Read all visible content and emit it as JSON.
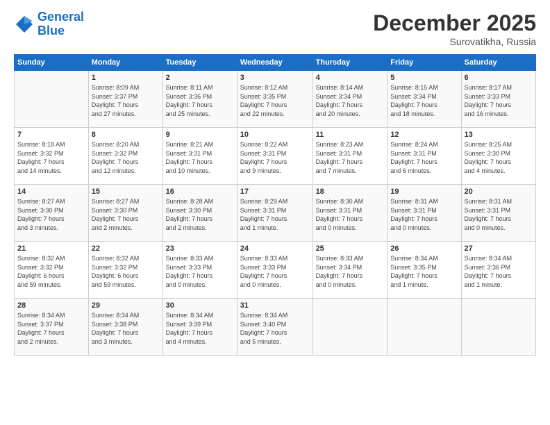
{
  "header": {
    "logo_line1": "General",
    "logo_line2": "Blue",
    "month": "December 2025",
    "location": "Surovatikha, Russia"
  },
  "weekdays": [
    "Sunday",
    "Monday",
    "Tuesday",
    "Wednesday",
    "Thursday",
    "Friday",
    "Saturday"
  ],
  "weeks": [
    [
      {
        "day": "",
        "info": ""
      },
      {
        "day": "1",
        "info": "Sunrise: 8:09 AM\nSunset: 3:37 PM\nDaylight: 7 hours\nand 27 minutes."
      },
      {
        "day": "2",
        "info": "Sunrise: 8:11 AM\nSunset: 3:36 PM\nDaylight: 7 hours\nand 25 minutes."
      },
      {
        "day": "3",
        "info": "Sunrise: 8:12 AM\nSunset: 3:35 PM\nDaylight: 7 hours\nand 22 minutes."
      },
      {
        "day": "4",
        "info": "Sunrise: 8:14 AM\nSunset: 3:34 PM\nDaylight: 7 hours\nand 20 minutes."
      },
      {
        "day": "5",
        "info": "Sunrise: 8:15 AM\nSunset: 3:34 PM\nDaylight: 7 hours\nand 18 minutes."
      },
      {
        "day": "6",
        "info": "Sunrise: 8:17 AM\nSunset: 3:33 PM\nDaylight: 7 hours\nand 16 minutes."
      }
    ],
    [
      {
        "day": "7",
        "info": "Sunrise: 8:18 AM\nSunset: 3:32 PM\nDaylight: 7 hours\nand 14 minutes."
      },
      {
        "day": "8",
        "info": "Sunrise: 8:20 AM\nSunset: 3:32 PM\nDaylight: 7 hours\nand 12 minutes."
      },
      {
        "day": "9",
        "info": "Sunrise: 8:21 AM\nSunset: 3:31 PM\nDaylight: 7 hours\nand 10 minutes."
      },
      {
        "day": "10",
        "info": "Sunrise: 8:22 AM\nSunset: 3:31 PM\nDaylight: 7 hours\nand 9 minutes."
      },
      {
        "day": "11",
        "info": "Sunrise: 8:23 AM\nSunset: 3:31 PM\nDaylight: 7 hours\nand 7 minutes."
      },
      {
        "day": "12",
        "info": "Sunrise: 8:24 AM\nSunset: 3:31 PM\nDaylight: 7 hours\nand 6 minutes."
      },
      {
        "day": "13",
        "info": "Sunrise: 8:25 AM\nSunset: 3:30 PM\nDaylight: 7 hours\nand 4 minutes."
      }
    ],
    [
      {
        "day": "14",
        "info": "Sunrise: 8:27 AM\nSunset: 3:30 PM\nDaylight: 7 hours\nand 3 minutes."
      },
      {
        "day": "15",
        "info": "Sunrise: 8:27 AM\nSunset: 3:30 PM\nDaylight: 7 hours\nand 2 minutes."
      },
      {
        "day": "16",
        "info": "Sunrise: 8:28 AM\nSunset: 3:30 PM\nDaylight: 7 hours\nand 2 minutes."
      },
      {
        "day": "17",
        "info": "Sunrise: 8:29 AM\nSunset: 3:31 PM\nDaylight: 7 hours\nand 1 minute."
      },
      {
        "day": "18",
        "info": "Sunrise: 8:30 AM\nSunset: 3:31 PM\nDaylight: 7 hours\nand 0 minutes."
      },
      {
        "day": "19",
        "info": "Sunrise: 8:31 AM\nSunset: 3:31 PM\nDaylight: 7 hours\nand 0 minutes."
      },
      {
        "day": "20",
        "info": "Sunrise: 8:31 AM\nSunset: 3:31 PM\nDaylight: 7 hours\nand 0 minutes."
      }
    ],
    [
      {
        "day": "21",
        "info": "Sunrise: 8:32 AM\nSunset: 3:32 PM\nDaylight: 6 hours\nand 59 minutes."
      },
      {
        "day": "22",
        "info": "Sunrise: 8:32 AM\nSunset: 3:32 PM\nDaylight: 6 hours\nand 59 minutes."
      },
      {
        "day": "23",
        "info": "Sunrise: 8:33 AM\nSunset: 3:33 PM\nDaylight: 7 hours\nand 0 minutes."
      },
      {
        "day": "24",
        "info": "Sunrise: 8:33 AM\nSunset: 3:33 PM\nDaylight: 7 hours\nand 0 minutes."
      },
      {
        "day": "25",
        "info": "Sunrise: 8:33 AM\nSunset: 3:34 PM\nDaylight: 7 hours\nand 0 minutes."
      },
      {
        "day": "26",
        "info": "Sunrise: 8:34 AM\nSunset: 3:35 PM\nDaylight: 7 hours\nand 1 minute."
      },
      {
        "day": "27",
        "info": "Sunrise: 8:34 AM\nSunset: 3:36 PM\nDaylight: 7 hours\nand 1 minute."
      }
    ],
    [
      {
        "day": "28",
        "info": "Sunrise: 8:34 AM\nSunset: 3:37 PM\nDaylight: 7 hours\nand 2 minutes."
      },
      {
        "day": "29",
        "info": "Sunrise: 8:34 AM\nSunset: 3:38 PM\nDaylight: 7 hours\nand 3 minutes."
      },
      {
        "day": "30",
        "info": "Sunrise: 8:34 AM\nSunset: 3:39 PM\nDaylight: 7 hours\nand 4 minutes."
      },
      {
        "day": "31",
        "info": "Sunrise: 8:34 AM\nSunset: 3:40 PM\nDaylight: 7 hours\nand 5 minutes."
      },
      {
        "day": "",
        "info": ""
      },
      {
        "day": "",
        "info": ""
      },
      {
        "day": "",
        "info": ""
      }
    ]
  ]
}
